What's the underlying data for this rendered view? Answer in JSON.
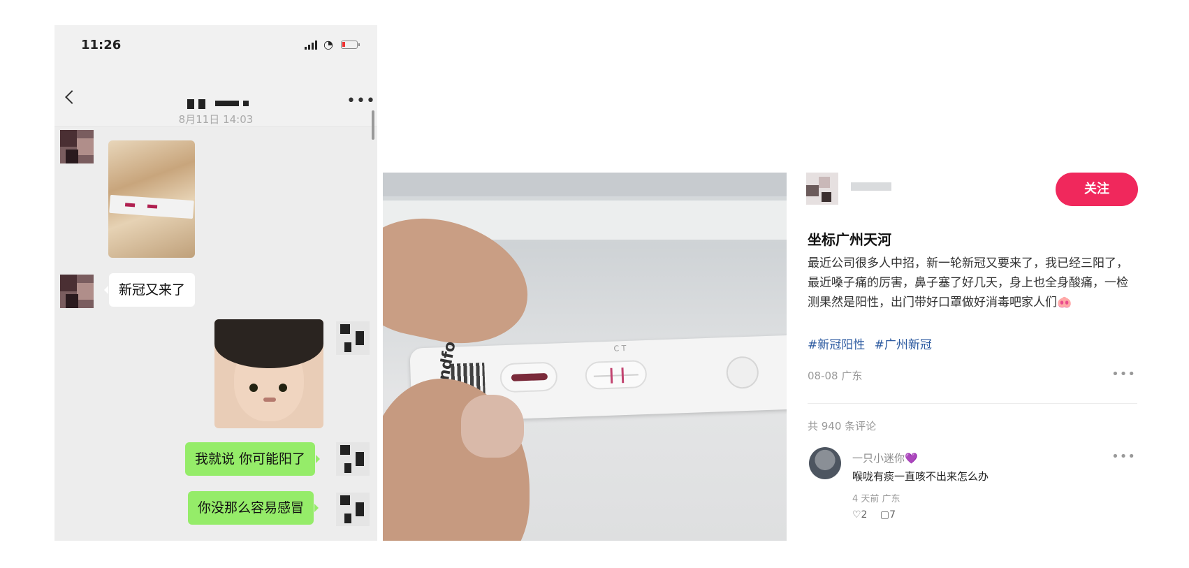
{
  "chat": {
    "status_time": "11:26",
    "timestamp": "8月11日 14:03",
    "messages": {
      "m1": "新冠又来了",
      "m2": "我就说 你可能阳了",
      "m3": "你没那么容易感冒"
    }
  },
  "photo": {
    "brand_text": "Wondfo",
    "control_test_marks": "C T"
  },
  "post": {
    "follow_label": "关注",
    "title": "坐标广州天河",
    "body": "最近公司很多人中招，新一轮新冠又要来了，我已经三阳了，最近嗓子痛的厉害，鼻子塞了好几天，身上也全身酸痛，一检测果然是阳性，出门带好口罩做好消毒吧家人们🐽",
    "tags": [
      "#新冠阳性",
      "#广州新冠"
    ],
    "meta": "08-08 广东",
    "comment_count": "共 940 条评论",
    "comment": {
      "author": "一只小迷你",
      "author_badge": "💜",
      "text": "喉咙有痰一直咳不出来怎么办",
      "meta": "4 天前 广东",
      "likes": "♡2",
      "replies": "▢7"
    }
  },
  "colors": {
    "follow_button": "#f0285c",
    "chat_green_bubble": "#95ec69",
    "tag_blue": "#2c5aa0"
  }
}
